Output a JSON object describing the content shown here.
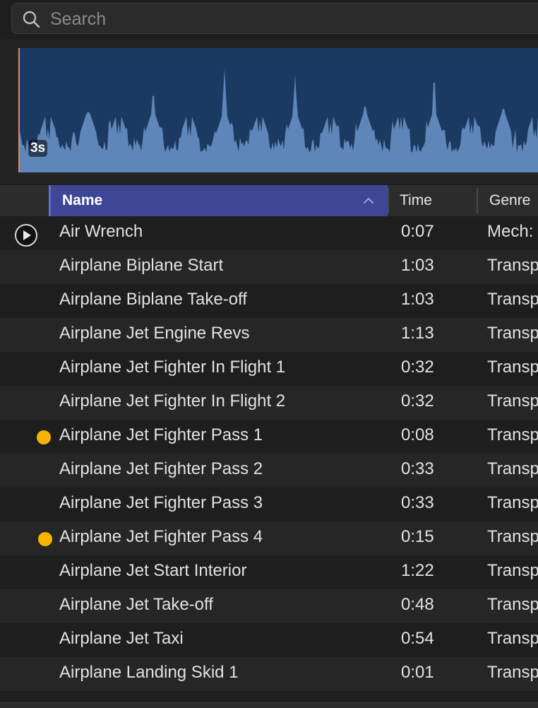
{
  "search": {
    "placeholder": "Search",
    "value": ""
  },
  "waveform": {
    "duration_label": "3s",
    "colors": {
      "background": "#1b3a61",
      "wave": "#5f86b8",
      "playhead": "#d78a6a"
    }
  },
  "columns": {
    "name": "Name",
    "time": "Time",
    "genre": "Genre",
    "sort_column": "Name",
    "sort_direction": "ascending"
  },
  "rows": [
    {
      "name": "Air Wrench",
      "time": "0:07",
      "genre": "Mech:",
      "marker": "play"
    },
    {
      "name": "Airplane Biplane Start",
      "time": "1:03",
      "genre": "Transp",
      "marker": ""
    },
    {
      "name": "Airplane Biplane Take-off",
      "time": "1:03",
      "genre": "Transp",
      "marker": ""
    },
    {
      "name": "Airplane Jet Engine Revs",
      "time": "1:13",
      "genre": "Transp",
      "marker": ""
    },
    {
      "name": "Airplane Jet Fighter In Flight 1",
      "time": "0:32",
      "genre": "Transp",
      "marker": ""
    },
    {
      "name": "Airplane Jet Fighter In Flight 2",
      "time": "0:32",
      "genre": "Transp",
      "marker": ""
    },
    {
      "name": "Airplane Jet Fighter Pass 1",
      "time": "0:08",
      "genre": "Transp",
      "marker": "dot"
    },
    {
      "name": "Airplane Jet Fighter Pass 2",
      "time": "0:33",
      "genre": "Transp",
      "marker": ""
    },
    {
      "name": "Airplane Jet Fighter Pass 3",
      "time": "0:33",
      "genre": "Transp",
      "marker": ""
    },
    {
      "name": "Airplane Jet Fighter Pass 4",
      "time": "0:15",
      "genre": "Transp",
      "marker": "dot"
    },
    {
      "name": "Airplane Jet Start Interior",
      "time": "1:22",
      "genre": "Transp",
      "marker": ""
    },
    {
      "name": "Airplane Jet Take-off",
      "time": "0:48",
      "genre": "Transp",
      "marker": ""
    },
    {
      "name": "Airplane Jet Taxi",
      "time": "0:54",
      "genre": "Transp",
      "marker": ""
    },
    {
      "name": "Airplane Landing Skid 1",
      "time": "0:01",
      "genre": "Transp",
      "marker": ""
    }
  ],
  "colors": {
    "marker_dot": "#f5b400",
    "header_selected": "#3d4796"
  }
}
